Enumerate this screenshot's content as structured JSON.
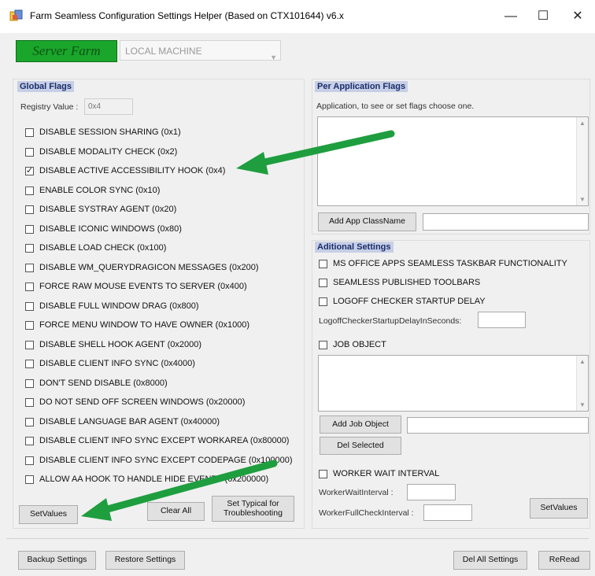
{
  "window": {
    "title": "Farm Seamless Configuration Settings Helper (Based on CTX101644) v6.x",
    "minimize": "—",
    "maximize": "☐",
    "close": "✕"
  },
  "header": {
    "server_farm_label": "Server Farm",
    "machine_value": "LOCAL MACHINE"
  },
  "global_flags": {
    "title": "Global Flags",
    "registry_label": "Registry Value :",
    "registry_value": "0x4",
    "flags": [
      {
        "label": "DISABLE SESSION SHARING (0x1)",
        "checked": false
      },
      {
        "label": "DISABLE MODALITY CHECK (0x2)",
        "checked": false
      },
      {
        "label": "DISABLE ACTIVE ACCESSIBILITY HOOK (0x4)",
        "checked": true
      },
      {
        "label": "ENABLE COLOR SYNC (0x10)",
        "checked": false
      },
      {
        "label": "DISABLE SYSTRAY AGENT (0x20)",
        "checked": false
      },
      {
        "label": "DISABLE ICONIC WINDOWS (0x80)",
        "checked": false
      },
      {
        "label": "DISABLE LOAD CHECK (0x100)",
        "checked": false
      },
      {
        "label": "DISABLE WM_QUERYDRAGICON MESSAGES (0x200)",
        "checked": false
      },
      {
        "label": "FORCE RAW MOUSE EVENTS TO SERVER (0x400)",
        "checked": false
      },
      {
        "label": "DISABLE FULL WINDOW DRAG (0x800)",
        "checked": false
      },
      {
        "label": "FORCE MENU WINDOW TO HAVE OWNER (0x1000)",
        "checked": false
      },
      {
        "label": "DISABLE SHELL HOOK AGENT (0x2000)",
        "checked": false
      },
      {
        "label": "DISABLE CLIENT INFO SYNC (0x4000)",
        "checked": false
      },
      {
        "label": "DON'T SEND DISABLE (0x8000)",
        "checked": false
      },
      {
        "label": "DO NOT SEND OFF SCREEN WINDOWS (0x20000)",
        "checked": false
      },
      {
        "label": "DISABLE LANGUAGE BAR AGENT (0x40000)",
        "checked": false
      },
      {
        "label": "DISABLE CLIENT INFO SYNC EXCEPT WORKAREA (0x80000)",
        "checked": false
      },
      {
        "label": "DISABLE CLIENT INFO SYNC EXCEPT CODEPAGE (0x100000)",
        "checked": false
      },
      {
        "label": "ALLOW AA HOOK TO HANDLE HIDE EVENTS (0x200000)",
        "checked": false
      }
    ],
    "set_values": "SetValues",
    "clear_all": "Clear All",
    "set_typical_line1": "Set Typical for",
    "set_typical_line2": "Troubleshooting"
  },
  "per_app": {
    "title": "Per Application Flags",
    "hint": "Application, to see or set flags choose one.",
    "add_app_button": "Add App ClassName"
  },
  "additional": {
    "title": "Aditional Settings",
    "ms_office": "MS OFFICE APPS SEAMLESS TASKBAR FUNCTIONALITY",
    "seamless_toolbars": "SEAMLESS PUBLISHED TOOLBARS",
    "logoff_checker": "LOGOFF CHECKER STARTUP DELAY",
    "logoff_delay_label": "LogoffCheckerStartupDelayInSeconds:",
    "job_object": "JOB OBJECT",
    "add_job_button": "Add Job Object",
    "del_selected_button": "Del Selected",
    "worker_wait": "WORKER WAIT INTERVAL",
    "worker_wait_label": "WorkerWaitInterval :",
    "worker_full_label": "WorkerFullCheckInterval :",
    "set_values": "SetValues"
  },
  "bottom": {
    "backup": "Backup Settings",
    "restore": "Restore Settings",
    "del_all": "Del All Settings",
    "reread": "ReRead"
  },
  "colors": {
    "server_farm_bg": "#1aa52b",
    "group_title_bg": "#c7cfe6",
    "arrow_green": "#1e9e3e"
  }
}
